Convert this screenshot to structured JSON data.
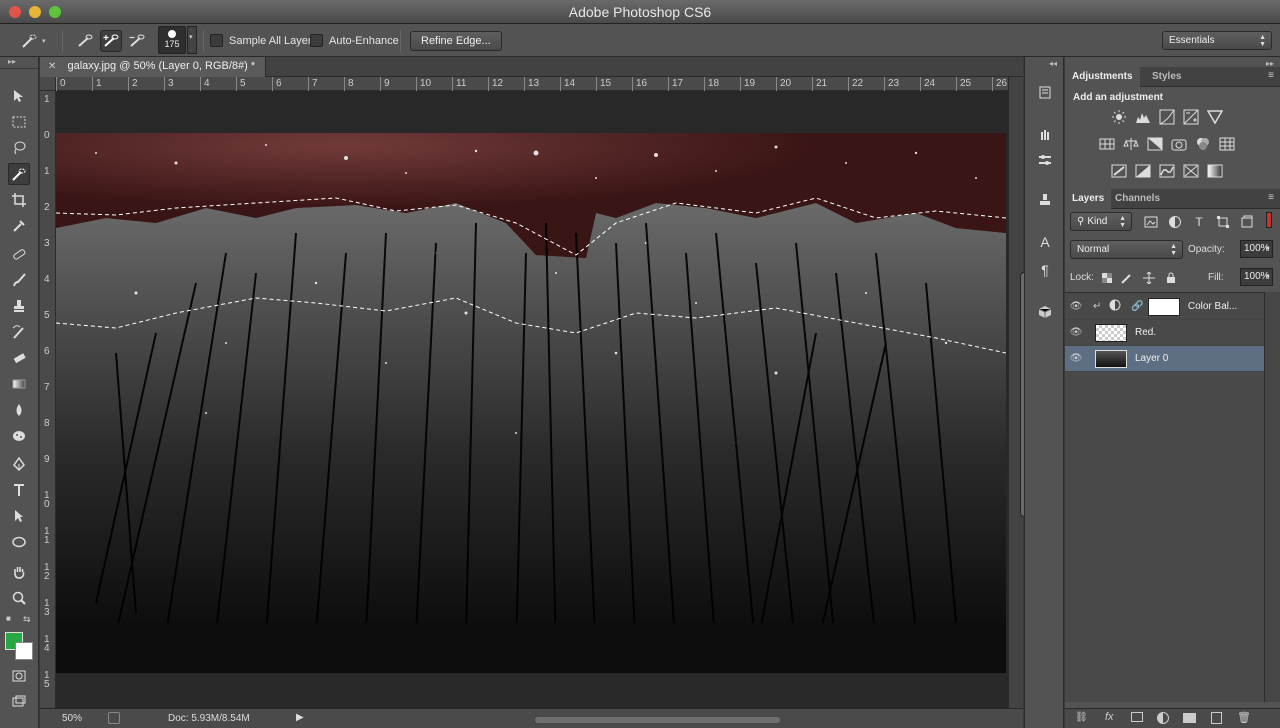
{
  "app": {
    "title": "Adobe Photoshop CS6"
  },
  "options": {
    "brush_size": "175",
    "sample_all_layers": "Sample All Layers",
    "auto_enhance": "Auto-Enhance",
    "refine_edge": "Refine Edge...",
    "workspace": "Essentials"
  },
  "document": {
    "tab_title": "galaxy.jpg @ 50% (Layer 0, RGB/8#) *",
    "ruler_h": [
      "0",
      "1",
      "2",
      "3",
      "4",
      "5",
      "6",
      "7",
      "8",
      "9",
      "10",
      "11",
      "12",
      "13",
      "14",
      "15",
      "16",
      "17",
      "18",
      "19",
      "20",
      "21",
      "22",
      "23",
      "24",
      "25",
      "26"
    ],
    "ruler_v": [
      "1",
      "0",
      "1",
      "2",
      "3",
      "4",
      "5",
      "6",
      "7",
      "8",
      "9",
      "1\n0",
      "1\n1",
      "1\n2",
      "1\n3",
      "1\n4",
      "1\n5"
    ]
  },
  "status": {
    "zoom": "50%",
    "doc": "Doc: 5.93M/8.54M"
  },
  "adjustments": {
    "tab": "Adjustments",
    "styles_tab": "Styles",
    "title": "Add an adjustment"
  },
  "layers": {
    "tab": "Layers",
    "channels_tab": "Channels",
    "kind": "Kind",
    "blend_mode": "Normal",
    "opacity_label": "Opacity:",
    "opacity": "100%",
    "lock_label": "Lock:",
    "fill_label": "Fill:",
    "fill": "100%",
    "items": [
      {
        "name": "Color Bal..."
      },
      {
        "name": "Red."
      },
      {
        "name": "Layer 0"
      }
    ]
  },
  "colors": {
    "foreground": "#27a845",
    "background": "#ffffff",
    "selected_layer": "#5f6f83"
  }
}
